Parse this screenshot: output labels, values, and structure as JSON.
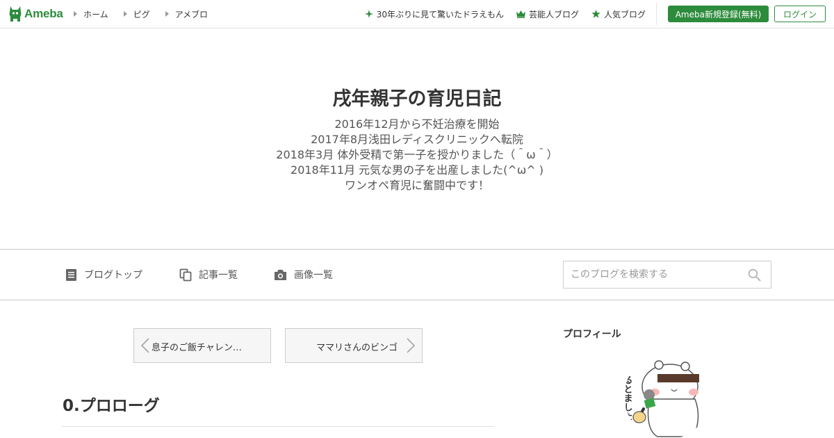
{
  "header": {
    "logo_text": "Ameba",
    "nav": [
      "ホーム",
      "ピグ",
      "アメブロ"
    ],
    "links": [
      {
        "label": "30年ぶりに見て驚いたドラえもん",
        "icon": "sparkle-icon"
      },
      {
        "label": "芸能人ブログ",
        "icon": "crown-icon"
      },
      {
        "label": "人気ブログ",
        "icon": "star-icon"
      }
    ],
    "register_label": "Ameba新規登録(無料)",
    "login_label": "ログイン"
  },
  "blog": {
    "title": "戌年親子の育児日記",
    "description": [
      "2016年12月から不妊治療を開始",
      "2017年8月浅田レディスクリニックへ転院",
      "2018年3月 体外受精で第一子を授かりました（＾ω＾）",
      "2018年11月 元気な男の子を出産しました(^ω^ )",
      "ワンオペ育児に奮闘中です！"
    ]
  },
  "blognav": {
    "top_label": "ブログトップ",
    "entries_label": "記事一覧",
    "images_label": "画像一覧",
    "search_placeholder": "このブログを検索する"
  },
  "pager": {
    "prev_label": "息子のご飯チャレン…",
    "next_label": "ママリさんのビンゴ"
  },
  "post": {
    "title": "0.プロローグ"
  },
  "sidebar": {
    "profile_heading": "プロフィール",
    "avatar_text": "るとました"
  },
  "colors": {
    "brand_green": "#2d8c3c",
    "border": "#cccccc"
  }
}
